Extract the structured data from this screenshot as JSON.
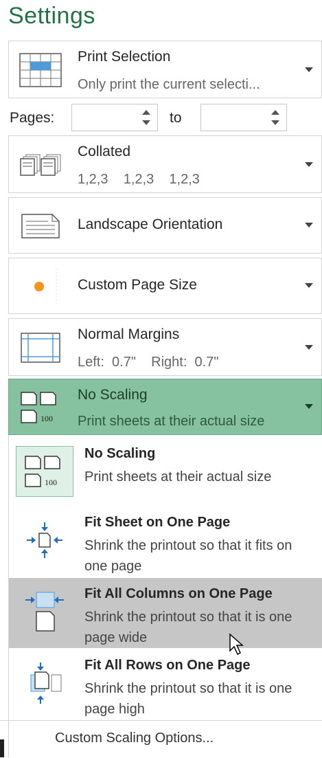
{
  "title": "Settings",
  "print_what": {
    "main": "Print Selection",
    "sub": "Only print the current selecti..."
  },
  "pages": {
    "label": "Pages:",
    "from": "",
    "to_label": "to",
    "to": ""
  },
  "collate": {
    "main": "Collated",
    "sub": "1,2,3    1,2,3    1,2,3"
  },
  "orientation": {
    "main": "Landscape Orientation"
  },
  "page_size": {
    "main": "Custom Page Size"
  },
  "margins": {
    "main": "Normal Margins",
    "sub": "Left:  0.7\"    Right:  0.7\""
  },
  "scaling": {
    "main": "No Scaling",
    "sub": "Print sheets at their actual size"
  },
  "scaling_menu": {
    "items": [
      {
        "title": "No Scaling",
        "desc": "Print sheets at their actual size"
      },
      {
        "title": "Fit Sheet on One Page",
        "desc": "Shrink the printout so that it fits on one page"
      },
      {
        "title": "Fit All Columns on One Page",
        "desc": "Shrink the printout so that it is one page wide"
      },
      {
        "title": "Fit All Rows on One Page",
        "desc": "Shrink the printout so that it is one page high"
      }
    ],
    "custom": "Custom Scaling Options...",
    "hundred": "100"
  },
  "colors": {
    "accent": "#217346",
    "selected": "#86c1a0",
    "hover": "#c6c6c6"
  }
}
